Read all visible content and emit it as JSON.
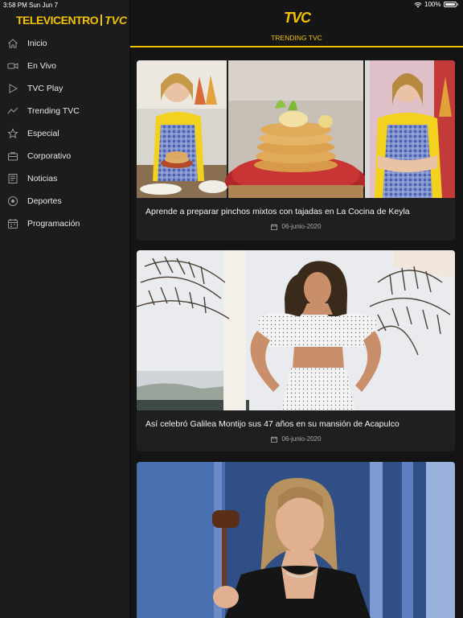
{
  "status_bar": {
    "time": "3:58 PM",
    "date": "Sun Jun 7",
    "battery": "100%"
  },
  "brand": {
    "word": "TELEVICENTRO",
    "short": "TVC"
  },
  "sidebar": {
    "items": [
      {
        "label": "Inicio",
        "icon": "home-icon"
      },
      {
        "label": "En Vivo",
        "icon": "video-camera-icon"
      },
      {
        "label": "TVC Play",
        "icon": "play-icon"
      },
      {
        "label": "Trending TVC",
        "icon": "trending-icon"
      },
      {
        "label": "Especial",
        "icon": "star-icon"
      },
      {
        "label": "Corporativo",
        "icon": "briefcase-icon"
      },
      {
        "label": "Noticias",
        "icon": "newspaper-icon"
      },
      {
        "label": "Deportes",
        "icon": "soccer-ball-icon"
      },
      {
        "label": "Programación",
        "icon": "calendar-icon"
      }
    ]
  },
  "header": {
    "logo": "TVC",
    "section": "TRENDING TVC"
  },
  "articles": [
    {
      "title": "Aprende a preparar pinchos mixtos con tajadas en La Cocina de Keyla",
      "date": "06-junio-2020"
    },
    {
      "title": "Así celebró Galilea Montijo sus 47 años en su mansión de Acapulco",
      "date": "06-junio-2020"
    }
  ],
  "colors": {
    "accent": "#f2c200",
    "background": "#141414",
    "sidebar": "#1c1c1c",
    "card": "#1f1f1f"
  }
}
